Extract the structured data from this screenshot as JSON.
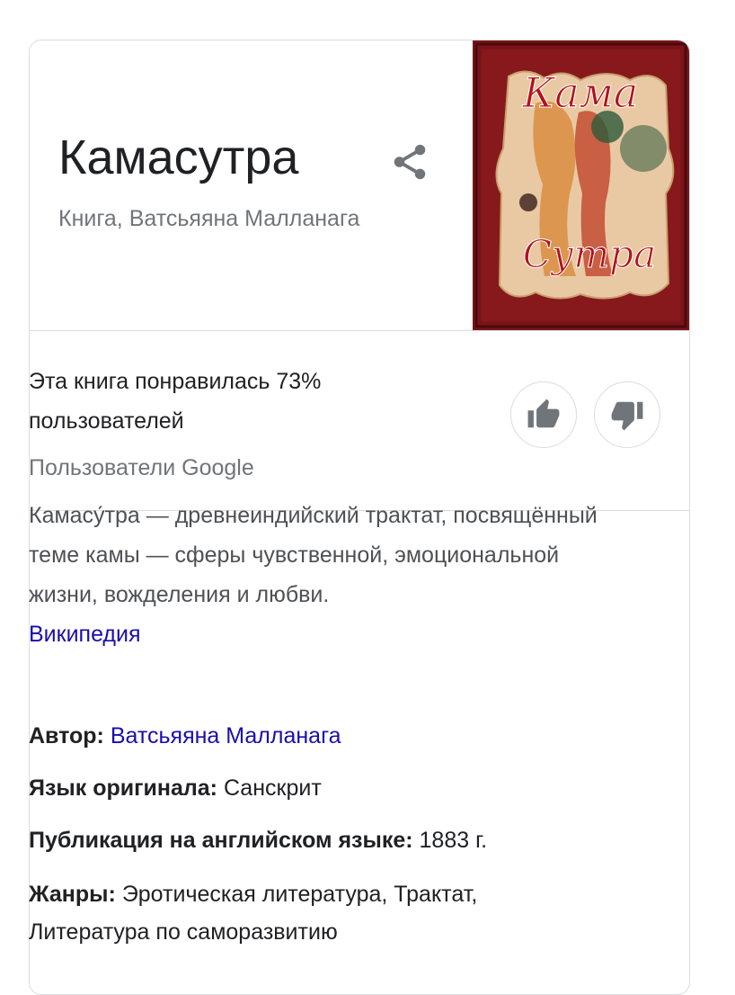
{
  "panel": {
    "title": "Камасутра",
    "subtitle": "Книга, Ватсьяяна Малланага",
    "share_icon": "share-icon",
    "cover": {
      "title_top": "Кама",
      "title_bottom": "Сутра",
      "colors": {
        "frame": "#7a1418",
        "panel": "#e9c9a4",
        "script": "#b3121b"
      }
    }
  },
  "rating": {
    "line1": "Эта книга понравилась 73%",
    "line2": "пользователей",
    "source": "Пользователи Google",
    "percent": 73,
    "like_icon": "thumbs-up-icon",
    "dislike_icon": "thumbs-down-icon"
  },
  "description": {
    "text": "Камасу́тра — древнеиндийский трактат, посвящённый теме камы — сферы чувственной, эмоциональной жизни, вожделения и любви.",
    "source_link": "Википедия"
  },
  "facts": [
    {
      "label": "Автор:",
      "value": "Ватсьяяна Малланага",
      "is_link": true
    },
    {
      "label": "Язык оригинала:",
      "value": "Санскрит",
      "is_link": false
    },
    {
      "label": "Публикация на английском языке:",
      "value": "1883 г.",
      "is_link": false
    },
    {
      "label": "Жанры:",
      "value": "Эротическая литература, Трактат, Литература по саморазвитию",
      "is_link": false
    }
  ],
  "colors": {
    "link": "#1a0dab",
    "border": "#dadce0",
    "muted": "#70757a",
    "icon": "#70757a"
  }
}
